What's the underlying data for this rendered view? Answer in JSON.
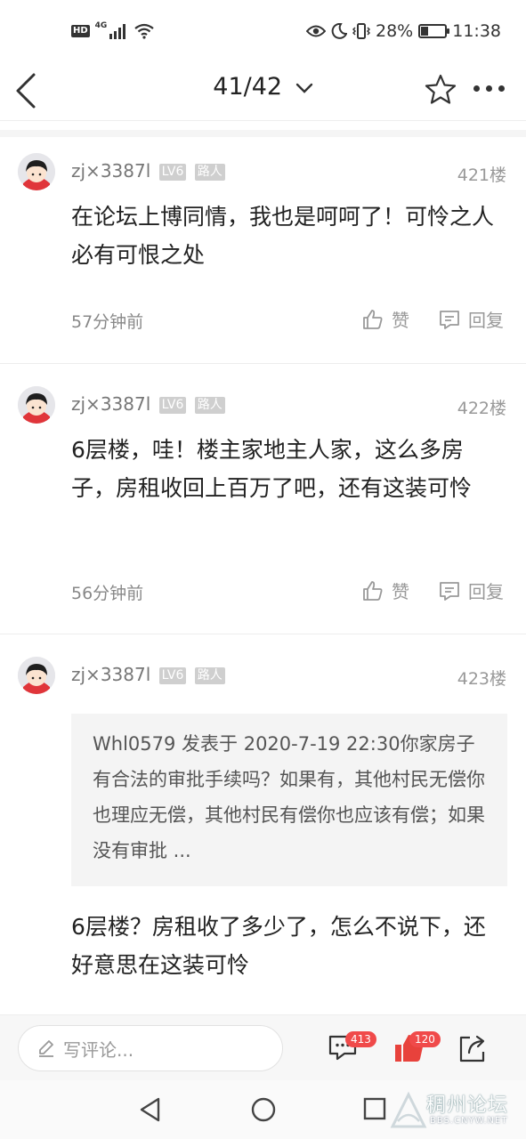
{
  "status_bar": {
    "hd": "HD",
    "network": "4G",
    "battery": "28%",
    "battery_level": 0.28,
    "time": "11:38",
    "icons": [
      "eye-icon",
      "moon-icon",
      "vibrate-icon",
      "battery-icon",
      "wifi-icon",
      "signal-icon"
    ]
  },
  "nav": {
    "page_indicator": "41/42"
  },
  "comments": [
    {
      "username": "zj×3387l",
      "level": "LV6",
      "role": "路人",
      "floor": "421楼",
      "text": "在论坛上博同情，我也是呵呵了！可怜之人必有可恨之处",
      "time": "57分钟前",
      "like_label": "赞",
      "reply_label": "回复"
    },
    {
      "username": "zj×3387l",
      "level": "LV6",
      "role": "路人",
      "floor": "422楼",
      "text": "6层楼，哇！楼主家地主人家，这么多房子，房租收回上百万了吧，还有这装可怜",
      "time": "56分钟前",
      "like_label": "赞",
      "reply_label": "回复"
    },
    {
      "username": "zj×3387l",
      "level": "LV6",
      "role": "路人",
      "floor": "423楼",
      "quote": "Whl0579 发表于 2020-7-19 22:30你家房子有合法的审批手续吗？如果有，其他村民无偿你也理应无偿，其他村民有偿你也应该有偿；如果没有审批 ...",
      "text": "6层楼？房租收了多少了，怎么不说下，还好意思在这装可怜"
    }
  ],
  "bottom_bar": {
    "placeholder": "写评论...",
    "comment_count": "413",
    "like_count": "120"
  },
  "watermark": {
    "title": "稠州论坛",
    "url": "BBS.CNYW.NET"
  },
  "colors": {
    "badge_red": "#f04a4a",
    "like_red": "#e8423c",
    "text": "#222222",
    "muted": "#999999"
  }
}
